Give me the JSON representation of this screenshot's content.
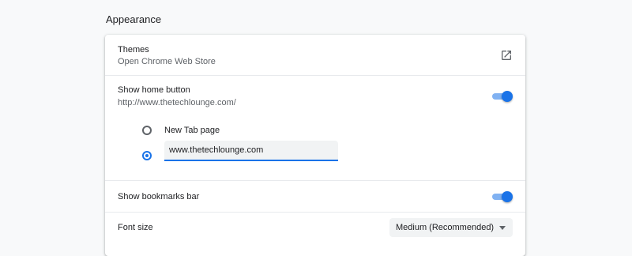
{
  "section": {
    "title": "Appearance"
  },
  "themes": {
    "label": "Themes",
    "sublabel": "Open Chrome Web Store",
    "icon": "open-in-new-icon"
  },
  "home_button": {
    "label": "Show home button",
    "sublabel": "http://www.thetechlounge.com/",
    "enabled": true,
    "options": [
      {
        "label": "New Tab page",
        "selected": false
      },
      {
        "label": "",
        "selected": true
      }
    ],
    "custom_url_value": "www.thetechlounge.com"
  },
  "bookmarks_bar": {
    "label": "Show bookmarks bar",
    "enabled": true
  },
  "font_size": {
    "label": "Font size",
    "selected": "Medium (Recommended)"
  },
  "colors": {
    "accent": "#1a73e8",
    "background": "#f8f9fa",
    "card": "#ffffff",
    "text_primary": "#202124",
    "text_secondary": "#5f6368"
  }
}
